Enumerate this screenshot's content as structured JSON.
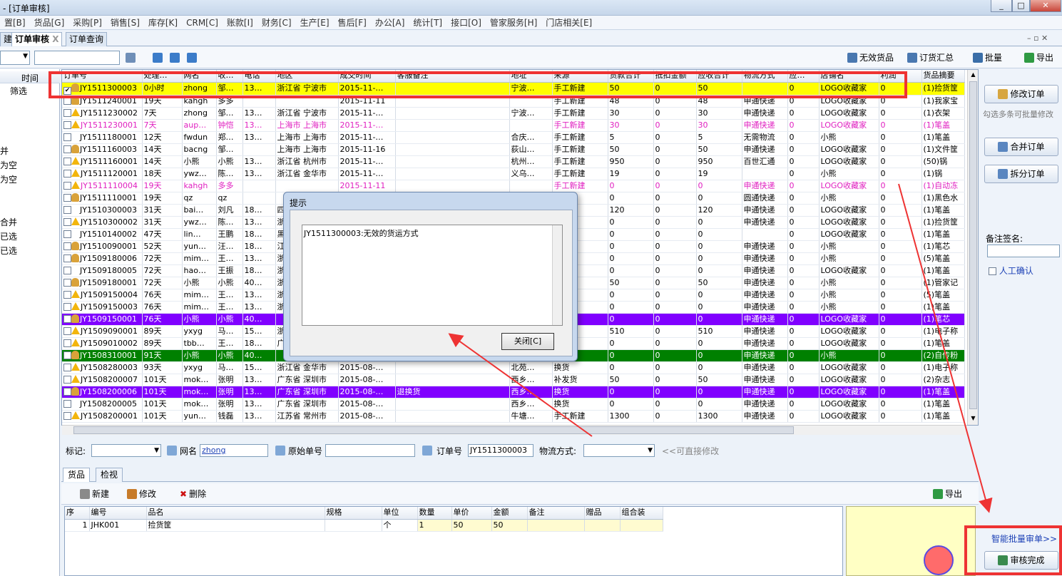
{
  "window": {
    "title": "- [订单审核]",
    "controls": [
      "_",
      "□",
      "✕"
    ]
  },
  "menu": [
    "置[B]",
    "货品[G]",
    "采购[P]",
    "销售[S]",
    "库存[K]",
    "CRM[C]",
    "账款[I]",
    "财务[C]",
    "生产[E]",
    "售后[F]",
    "办公[A]",
    "统计[T]",
    "接口[O]",
    "管家服务[H]",
    "门店相关[E]"
  ],
  "tabs": [
    {
      "label": "建"
    },
    {
      "label": "订单审核",
      "close": "X"
    },
    {
      "label": "订单查询"
    }
  ],
  "toolbar": {
    "invalid_goods": "无效货品",
    "order_summary": "订货汇总",
    "batch": "批量",
    "export": "导出"
  },
  "left_panel": {
    "header": "时间",
    "filter": "筛选",
    "items": [
      "并",
      "为空",
      "为空",
      "合并",
      "已选",
      "已选"
    ]
  },
  "grid": {
    "columns": [
      "订单号",
      "处理…",
      "网名",
      "收…",
      "电话",
      "地区",
      "成交时间",
      "客服备注",
      "地址",
      "来源",
      "货款合计",
      "抵扣金额",
      "应收合计",
      "物流方式",
      "应…",
      "店铺名",
      "利润",
      "货品摘要"
    ],
    "rows": [
      {
        "style": "yellow",
        "checked": true,
        "icon": "person",
        "cells": [
          "JY1511300003",
          "0小时",
          "zhong",
          "邹…",
          "13…",
          "浙江省 宁波市",
          "2015-11-…",
          "",
          "宁波…",
          "手工新建",
          "50",
          "0",
          "50",
          "",
          "0",
          "LOGO收藏家",
          "0",
          "(1)捡货筐"
        ]
      },
      {
        "style": "",
        "checked": false,
        "icon": "person",
        "cells": [
          "JY1511240001",
          "19天",
          "kahgh",
          "多多",
          "",
          "",
          "2015-11-11",
          "",
          "",
          "手工新建",
          "48",
          "0",
          "48",
          "申通快递",
          "0",
          "LOGO收藏家",
          "0",
          "(1)我家宝"
        ]
      },
      {
        "style": "",
        "checked": false,
        "icon": "warn",
        "cells": [
          "JY1511230002",
          "7天",
          "zhong",
          "邹…",
          "13…",
          "浙江省 宁波市",
          "2015-11-…",
          "",
          "宁波…",
          "手工新建",
          "30",
          "0",
          "30",
          "申通快递",
          "0",
          "LOGO收藏家",
          "0",
          "(1)衣架"
        ]
      },
      {
        "style": "pink",
        "checked": false,
        "icon": "warn",
        "cells": [
          "JY1511230001",
          "7天",
          "aup…",
          "钟恺",
          "13…",
          "上海市 上海市",
          "2015-11-…",
          "",
          "",
          "手工新建",
          "30",
          "0",
          "30",
          "申通快递",
          "0",
          "LOGO收藏家",
          "0",
          "(1)笔盖"
        ]
      },
      {
        "style": "",
        "checked": false,
        "icon": "",
        "cells": [
          "JY1511180001",
          "12天",
          "fwdun",
          "郑…",
          "13…",
          "上海市 上海市",
          "2015-11-…",
          "",
          "合庆…",
          "手工新建",
          "5",
          "0",
          "5",
          "无需物流",
          "0",
          "小熊",
          "0",
          "(1)笔盖"
        ]
      },
      {
        "style": "",
        "checked": false,
        "icon": "person",
        "cells": [
          "JY1511160003",
          "14天",
          "bacng",
          "邹…",
          "",
          "上海市 上海市",
          "2015-11-16",
          "",
          "荻山…",
          "手工新建",
          "50",
          "0",
          "50",
          "申通快递",
          "0",
          "LOGO收藏家",
          "0",
          "(1)文件筐"
        ]
      },
      {
        "style": "",
        "checked": false,
        "icon": "warn",
        "cells": [
          "JY1511160001",
          "14天",
          "小熊",
          "小熊",
          "13…",
          "浙江省 杭州市",
          "2015-11-…",
          "",
          "杭州…",
          "手工新建",
          "950",
          "0",
          "950",
          "百世汇通",
          "0",
          "LOGO收藏家",
          "0",
          "(50)锅"
        ]
      },
      {
        "style": "",
        "checked": false,
        "icon": "warn",
        "cells": [
          "JY1511120001",
          "18天",
          "ywz…",
          "陈…",
          "13…",
          "浙江省 金华市",
          "2015-11-…",
          "",
          "义乌…",
          "手工新建",
          "19",
          "0",
          "19",
          "",
          "0",
          "小熊",
          "0",
          "(1)锅"
        ]
      },
      {
        "style": "pink",
        "checked": false,
        "icon": "warn",
        "cells": [
          "JY1511110004",
          "19天",
          "kahgh",
          "多多",
          "",
          "",
          "2015-11-11",
          "",
          "",
          "手工新建",
          "0",
          "0",
          "0",
          "申通快递",
          "0",
          "LOGO收藏家",
          "0",
          "(1)自动冻"
        ]
      },
      {
        "style": "",
        "checked": false,
        "icon": "person",
        "cells": [
          "JY1511110001",
          "19天",
          "qz",
          "qz",
          "",
          "",
          "",
          "",
          "",
          "新建",
          "0",
          "0",
          "0",
          "圆通快递",
          "0",
          "小熊",
          "0",
          "(1)黑色水"
        ]
      },
      {
        "style": "",
        "checked": false,
        "icon": "",
        "cells": [
          "JY1510300003",
          "31天",
          "bai…",
          "刘凡",
          "18…",
          "四",
          "",
          "",
          "",
          "新建",
          "120",
          "0",
          "120",
          "申通快递",
          "0",
          "LOGO收藏家",
          "0",
          "(1)笔盖"
        ]
      },
      {
        "style": "",
        "checked": false,
        "icon": "warn",
        "cells": [
          "JY1510300002",
          "31天",
          "ywz…",
          "陈…",
          "13…",
          "浙",
          "",
          "",
          "",
          "",
          "0",
          "0",
          "0",
          "申通快递",
          "0",
          "LOGO收藏家",
          "0",
          "(1)捡货筐"
        ]
      },
      {
        "style": "",
        "checked": false,
        "icon": "",
        "cells": [
          "JY1510140002",
          "47天",
          "lin…",
          "王鹏",
          "18…",
          "黑",
          "",
          "",
          "",
          "",
          "0",
          "0",
          "0",
          "",
          "0",
          "LOGO收藏家",
          "0",
          "(1)笔盖"
        ]
      },
      {
        "style": "",
        "checked": false,
        "icon": "person",
        "cells": [
          "JY1510090001",
          "52天",
          "yun…",
          "汪…",
          "18…",
          "江",
          "",
          "",
          "",
          "新建",
          "0",
          "0",
          "0",
          "申通快递",
          "0",
          "小熊",
          "0",
          "(1)笔芯"
        ]
      },
      {
        "style": "",
        "checked": false,
        "icon": "person",
        "cells": [
          "JY1509180006",
          "72天",
          "mim…",
          "王…",
          "13…",
          "浙",
          "",
          "",
          "",
          "货",
          "0",
          "0",
          "0",
          "申通快递",
          "0",
          "小熊",
          "0",
          "(5)笔盖"
        ]
      },
      {
        "style": "",
        "checked": false,
        "icon": "",
        "cells": [
          "JY1509180005",
          "72天",
          "hao…",
          "王振",
          "18…",
          "浙",
          "",
          "",
          "",
          "",
          "0",
          "0",
          "0",
          "申通快递",
          "0",
          "LOGO收藏家",
          "0",
          "(1)笔盖"
        ]
      },
      {
        "style": "",
        "checked": false,
        "icon": "person",
        "cells": [
          "JY1509180001",
          "72天",
          "小熊",
          "小熊",
          "40…",
          "浙",
          "",
          "",
          "",
          "新建",
          "50",
          "0",
          "50",
          "申通快递",
          "0",
          "小熊",
          "0",
          "(1)管家记"
        ]
      },
      {
        "style": "",
        "checked": false,
        "icon": "warn",
        "cells": [
          "JY1509150004",
          "76天",
          "mim…",
          "王…",
          "13…",
          "浙",
          "",
          "",
          "",
          "货",
          "0",
          "0",
          "0",
          "申通快递",
          "0",
          "小熊",
          "0",
          "(5)笔盖"
        ]
      },
      {
        "style": "",
        "checked": false,
        "icon": "warn",
        "cells": [
          "JY1509150003",
          "76天",
          "mim…",
          "王…",
          "13…",
          "浙",
          "",
          "",
          "",
          "货",
          "0",
          "0",
          "0",
          "申通快递",
          "0",
          "小熊",
          "0",
          "(1)笔盖"
        ]
      },
      {
        "style": "purple",
        "checked": false,
        "icon": "person",
        "cells": [
          "JY1509150001",
          "76天",
          "小熊",
          "小熊",
          "40…",
          "",
          "",
          "",
          "",
          "新建",
          "0",
          "0",
          "0",
          "申通快递",
          "0",
          "LOGO收藏家",
          "0",
          "(1)笔芯"
        ]
      },
      {
        "style": "",
        "checked": false,
        "icon": "warn",
        "cells": [
          "JY1509090001",
          "89天",
          "yxyg",
          "马…",
          "15…",
          "浙",
          "",
          "",
          "",
          "货",
          "510",
          "0",
          "510",
          "申通快递",
          "0",
          "LOGO收藏家",
          "0",
          "(1)电子称"
        ]
      },
      {
        "style": "",
        "checked": false,
        "icon": "warn",
        "cells": [
          "JY1509010002",
          "89天",
          "tbb…",
          "王…",
          "18…",
          "广",
          "",
          "",
          "",
          "",
          "0",
          "0",
          "0",
          "申通快递",
          "0",
          "LOGO收藏家",
          "0",
          "(1)笔盖"
        ]
      },
      {
        "style": "green",
        "checked": false,
        "icon": "person",
        "cells": [
          "JY1508310001",
          "91天",
          "小熊",
          "小熊",
          "40…",
          "",
          "",
          "",
          "",
          "",
          "0",
          "0",
          "0",
          "申通快递",
          "0",
          "小熊",
          "0",
          "(2)自传粉"
        ]
      },
      {
        "style": "",
        "checked": false,
        "icon": "warn",
        "cells": [
          "JY1508280003",
          "93天",
          "yxyg",
          "马…",
          "15…",
          "浙江省 金华市",
          "2015-08-…",
          "",
          "北苑…",
          "换货",
          "0",
          "0",
          "0",
          "申通快递",
          "0",
          "LOGO收藏家",
          "0",
          "(1)电子称"
        ]
      },
      {
        "style": "",
        "checked": false,
        "icon": "warn",
        "cells": [
          "JY1508200007",
          "101天",
          "mok…",
          "张明",
          "13…",
          "广东省 深圳市",
          "2015-08-…",
          "",
          "西乡…",
          "补发货",
          "50",
          "0",
          "50",
          "申通快递",
          "0",
          "LOGO收藏家",
          "0",
          "(2)杂志"
        ]
      },
      {
        "style": "purple",
        "checked": false,
        "icon": "person",
        "cells": [
          "JY1508200006",
          "101天",
          "mok…",
          "张明",
          "13…",
          "广东省 深圳市",
          "2015-08-…",
          "退换货",
          "西乡…",
          "换货",
          "0",
          "0",
          "0",
          "申通快递",
          "0",
          "LOGO收藏家",
          "0",
          "(1)笔盖"
        ]
      },
      {
        "style": "",
        "checked": false,
        "icon": "",
        "cells": [
          "JY1508200005",
          "101天",
          "mok…",
          "张明",
          "13…",
          "广东省 深圳市",
          "2015-08-…",
          "",
          "西乡…",
          "换货",
          "0",
          "0",
          "0",
          "申通快递",
          "0",
          "LOGO收藏家",
          "0",
          "(1)笔盖"
        ]
      },
      {
        "style": "",
        "checked": false,
        "icon": "warn",
        "cells": [
          "JY1508200001",
          "101天",
          "yun…",
          "钱磊",
          "13…",
          "江苏省 常州市",
          "2015-08-…",
          "",
          "牛塘…",
          "手工新建",
          "1300",
          "0",
          "1300",
          "申通快递",
          "0",
          "LOGO收藏家",
          "0",
          "(1)笔盖"
        ]
      }
    ]
  },
  "right_panel": {
    "modify_order": "修改订单",
    "hint": "勾选多条可批量修改",
    "merge_order": "合并订单",
    "split_order": "拆分订单",
    "remark_label": "备注签名:",
    "manual_confirm": "人工确认",
    "smart_batch": "智能批量审单>>",
    "audit_done": "审核完成"
  },
  "mid_bar": {
    "tag_label": "标记:",
    "nick_label": "网名",
    "nick_value": "zhong",
    "orig_label": "原始单号",
    "order_label": "订单号",
    "order_value": "JY1511300003",
    "logistics_label": "物流方式:",
    "edit_hint": "<<可直接修改"
  },
  "lower_tabs": [
    "货品",
    "检视"
  ],
  "lower_toolbar": {
    "new": "新建",
    "edit": "修改",
    "delete": "删除",
    "export": "导出"
  },
  "items_grid": {
    "columns": [
      "序",
      "编号",
      "品名",
      "规格",
      "单位",
      "数量",
      "单价",
      "金额",
      "备注",
      "赠品",
      "组合装"
    ],
    "rows": [
      [
        "1",
        "JHK001",
        "捡货筐",
        "",
        "个",
        "1",
        "50",
        "50",
        "",
        "",
        ""
      ]
    ]
  },
  "dialog": {
    "title": "提示",
    "message": "JY1511300003:无效的货运方式",
    "close_button": "关闭[C]"
  },
  "colors": {
    "highlight": "#ffff00",
    "pink_row": "#e020c0",
    "purple_row": "#8000ff",
    "green_row": "#008000",
    "annotation": "#ee3333"
  }
}
